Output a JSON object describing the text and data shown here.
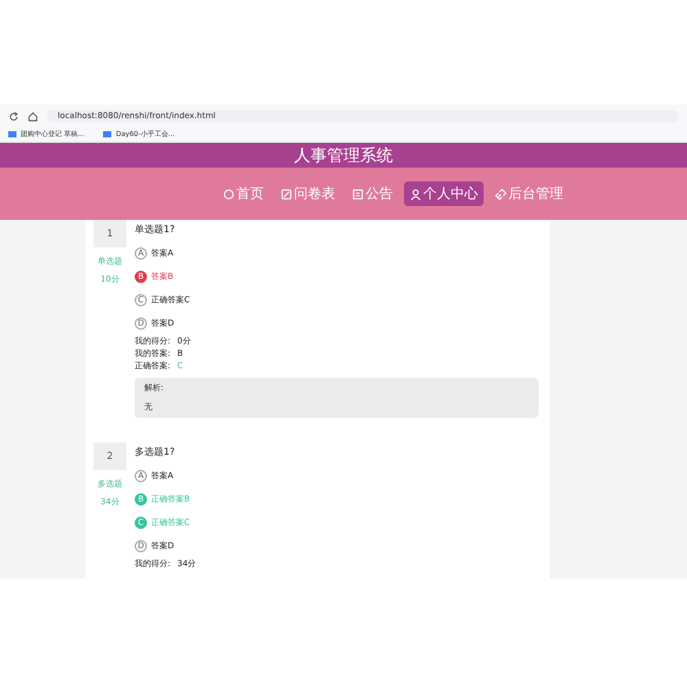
{
  "browser": {
    "url": "localhost:8080/renshi/front/index.html",
    "bookmarks": [
      "团购中心登记 草稿...",
      "Day60-小乎工会..."
    ]
  },
  "header": {
    "title": "人事管理系统"
  },
  "nav": [
    {
      "label": "首页",
      "selected": false
    },
    {
      "label": "问卷表",
      "selected": false
    },
    {
      "label": "公告",
      "selected": false
    },
    {
      "label": "个人中心",
      "selected": true
    },
    {
      "label": "后台管理",
      "selected": false
    }
  ],
  "questions": [
    {
      "number": "1",
      "type": "单选题",
      "points": "10分",
      "text": "单选题1?",
      "options": [
        {
          "letter": "A",
          "label": "答案A",
          "kind": "normal"
        },
        {
          "letter": "B",
          "label": "答案B",
          "kind": "wrong"
        },
        {
          "letter": "C",
          "label": "正确答案C",
          "kind": "normal"
        },
        {
          "letter": "D",
          "label": "答案D",
          "kind": "normal"
        }
      ],
      "results": [
        {
          "label": "我的得分:",
          "value": "0分",
          "kind": "plain"
        },
        {
          "label": "我的答案:",
          "value": "B",
          "kind": "plain"
        },
        {
          "label": "正确答案:",
          "value": "C",
          "kind": "correct"
        }
      ],
      "analysis": {
        "label": "解析:",
        "text": "无"
      }
    },
    {
      "number": "2",
      "type": "多选题",
      "points": "34分",
      "text": "多选题1?",
      "options": [
        {
          "letter": "A",
          "label": "答案A",
          "kind": "normal"
        },
        {
          "letter": "B",
          "label": "正确答案B",
          "kind": "correct"
        },
        {
          "letter": "C",
          "label": "正确答案C",
          "kind": "correct"
        },
        {
          "letter": "D",
          "label": "答案D",
          "kind": "normal"
        }
      ],
      "results": [
        {
          "label": "我的得分:",
          "value": "34分",
          "kind": "plain"
        }
      ]
    }
  ]
}
